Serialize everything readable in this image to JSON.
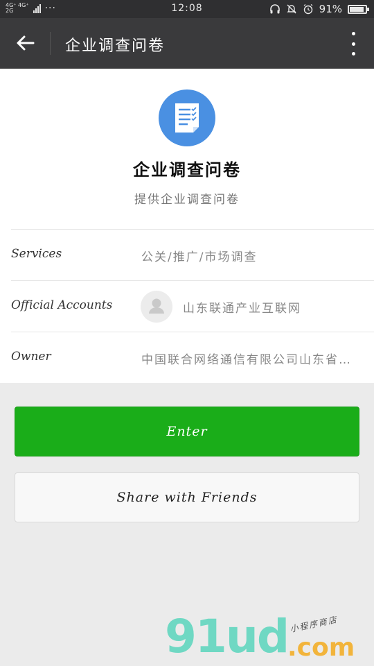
{
  "status_bar": {
    "network_top": "4G⁺ 4G⁺",
    "network_bottom": "2G",
    "dots": "···",
    "time": "12:08",
    "battery_text": "91%",
    "battery_level": 0.91
  },
  "navbar": {
    "title": "企业调查问卷",
    "back_icon": "arrow-left-icon",
    "more_icon": "more-vertical-icon"
  },
  "profile": {
    "name": "企业调查问卷",
    "description": "提供企业调查问卷",
    "logo_color": "#4a90e2"
  },
  "info_rows": [
    {
      "label": "Services",
      "value": "公关/推广/市场调查"
    },
    {
      "label": "Official Accounts",
      "value": "山东联通产业互联网"
    },
    {
      "label": "Owner",
      "value": "中国联合网络通信有限公司山东省分公司"
    }
  ],
  "buttons": {
    "enter_label": "Enter",
    "share_label": "Share with Friends"
  },
  "watermark": {
    "main": "91ud",
    "sub": ".com",
    "tag": "小程序商店"
  },
  "colors": {
    "accent_green": "#1aad19",
    "navbar": "#3a3a3c"
  }
}
